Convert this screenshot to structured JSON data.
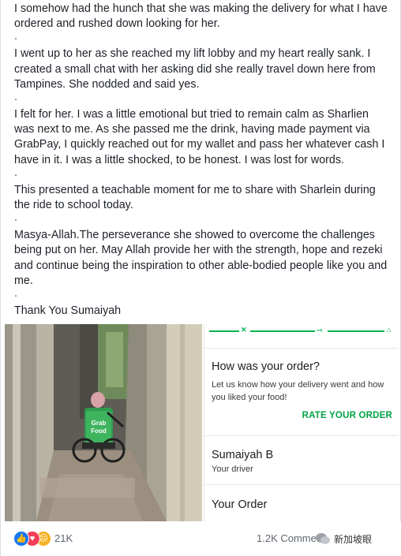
{
  "post": {
    "paragraphs": [
      "I somehow had the hunch that she was making the delivery for what I have ordered and rushed down looking for her.",
      "I went up to her as she reached my lift lobby and my heart really sank. I created a small chat with her asking did she really travel down here from Tampines. She nodded and said yes.",
      "I felt for her. I was a little emotional but tried to remain calm as Sharlien was next to me. As she passed me the drink, having made payment via GrabPay, I quickly reached out for my wallet and pass her whatever cash I have in it. I was a little shocked, to be honest. I was lost for words.",
      "This presented a teachable moment for me to share with Sharlein during the ride to school today.",
      "Masya-Allah.The perseverance she showed to overcome the challenges being put on her. May Allah provide her with the strength, hope and rezeki and continue being the inspiration to other able-bodied people like you and me.",
      "Thank You Sumaiyah"
    ],
    "separator": "."
  },
  "photo": {
    "bag_text_line1": "Grab",
    "bag_text_line2": "Food"
  },
  "app": {
    "accent_color": "#00b14f",
    "order_title": "How was your order?",
    "order_desc": "Let us know how your delivery went and how you liked your food!",
    "rate_button": "RATE YOUR ORDER",
    "driver_name": "Sumaiyah B",
    "driver_role": "Your driver",
    "your_order": "Your Order"
  },
  "footer": {
    "reaction_count": "21K",
    "comments": "1.2K Comme",
    "watermark": "新加坡眼"
  }
}
